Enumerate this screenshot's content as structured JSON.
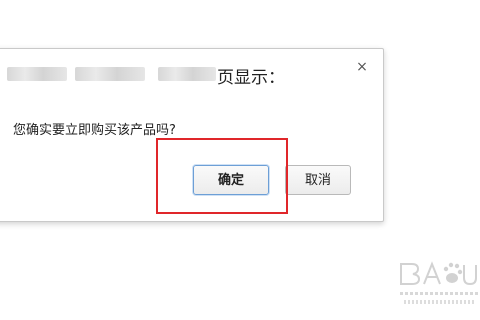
{
  "dialog": {
    "title_suffix": "页显示：",
    "close_symbol": "×",
    "message": "您确实要立即购买该产品吗?",
    "ok_label": "确定",
    "cancel_label": "取消"
  },
  "colors": {
    "highlight_box": "#e0262a",
    "ok_button_border": "#6d9fd6"
  }
}
